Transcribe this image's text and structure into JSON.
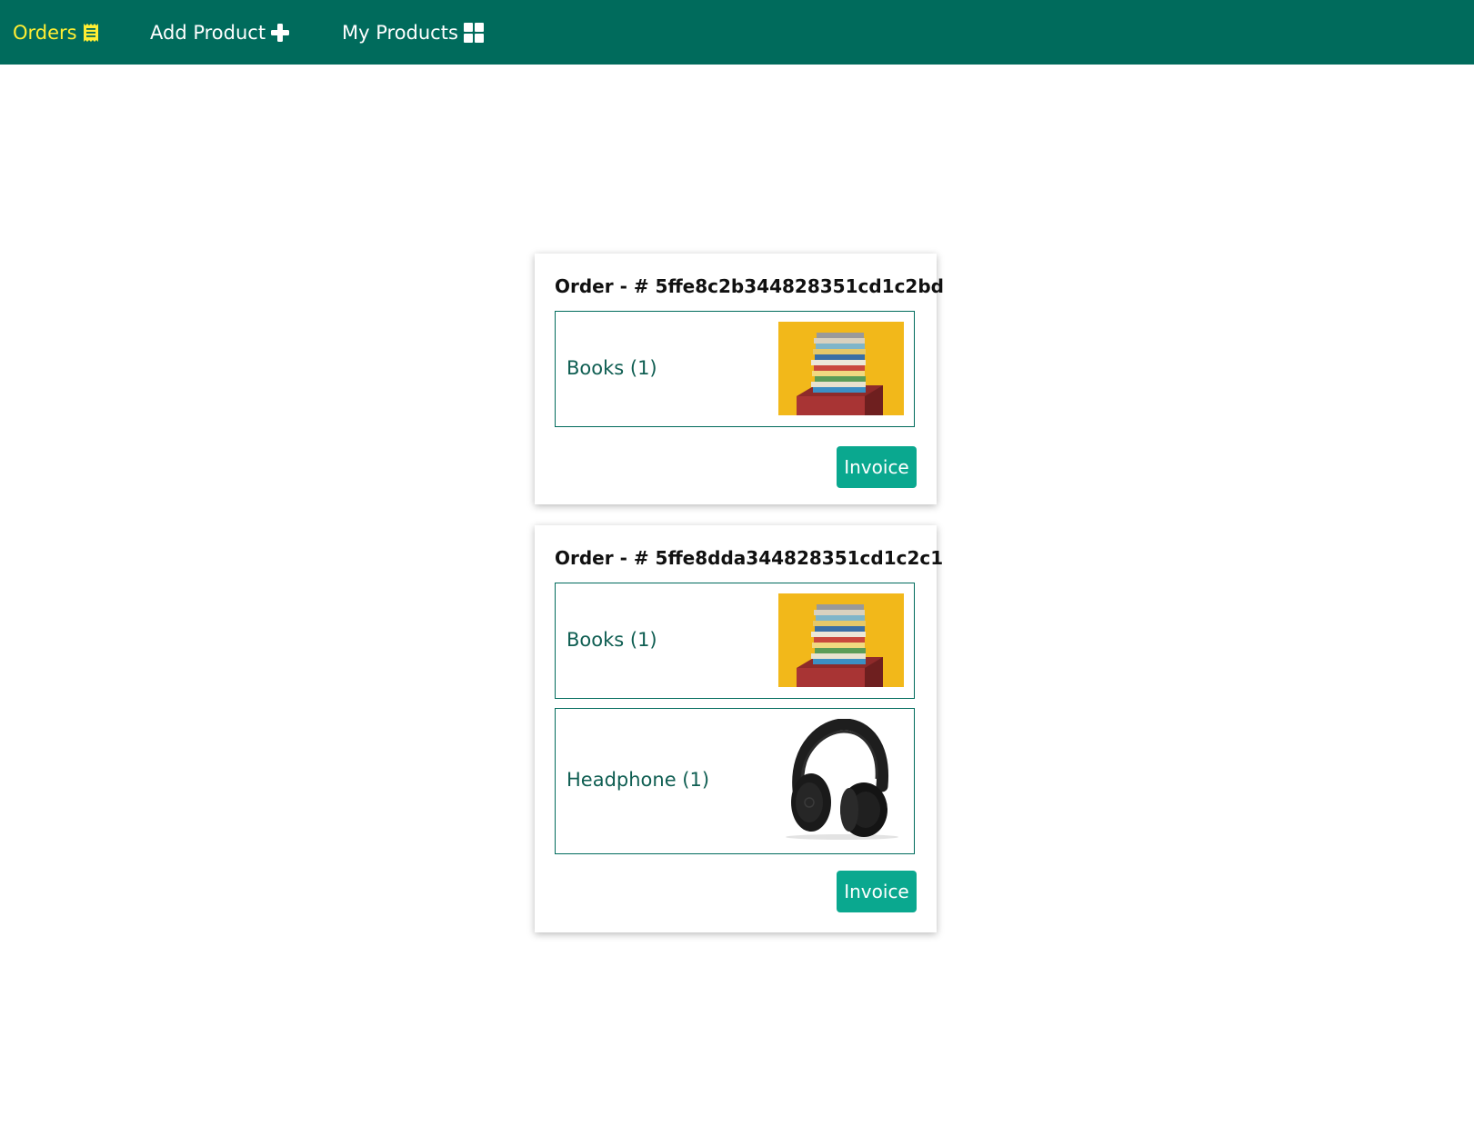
{
  "nav": {
    "orders_label": "Orders",
    "add_product_label": "Add Product",
    "my_products_label": "My Products",
    "active_color": "#ffee33",
    "background_color": "#006b5c"
  },
  "orders": [
    {
      "title": "Order - # 5ffe8c2b344828351cd1c2bd",
      "items": [
        {
          "label": "Books (1)",
          "image": "books-image"
        }
      ],
      "invoice_label": "Invoice"
    },
    {
      "title": "Order - # 5ffe8dda344828351cd1c2c1",
      "items": [
        {
          "label": "Books (1)",
          "image": "books-image"
        },
        {
          "label": "Headphone (1)",
          "image": "headphone-image"
        }
      ],
      "invoice_label": "Invoice"
    }
  ],
  "colors": {
    "accent_button": "#0aa88f",
    "item_text": "#0f5e52"
  }
}
